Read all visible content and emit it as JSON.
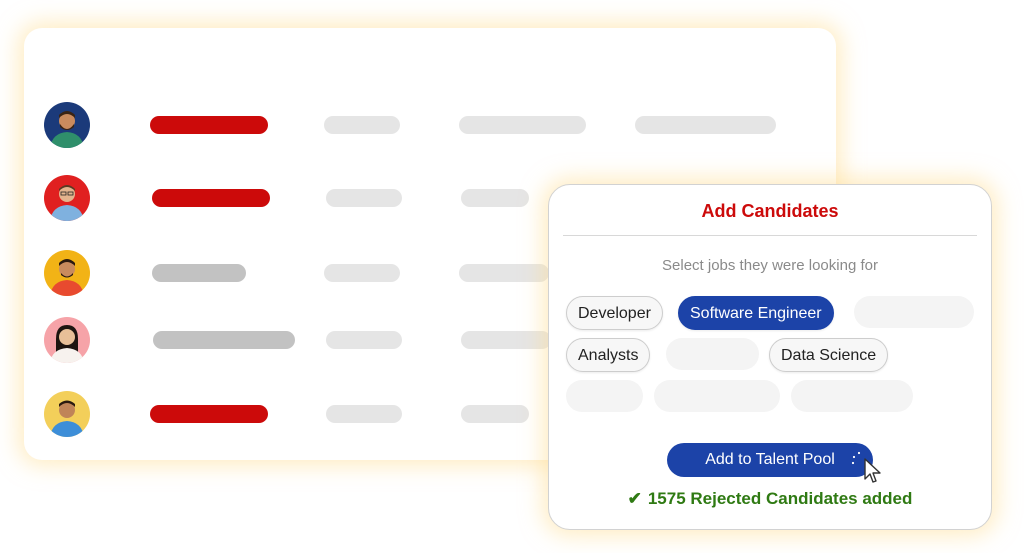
{
  "background_list": {
    "rows": [
      {
        "avatar": "person-avatar-1",
        "avatar_bg": "#1b3a7a",
        "status": "red"
      },
      {
        "avatar": "person-avatar-2",
        "avatar_bg": "#e02020",
        "status": "red"
      },
      {
        "avatar": "person-avatar-3",
        "avatar_bg": "#f2b316",
        "status": "gray"
      },
      {
        "avatar": "person-avatar-4",
        "avatar_bg": "#f6a3a8",
        "status": "gray"
      },
      {
        "avatar": "person-avatar-5",
        "avatar_bg": "#f3cf5a",
        "status": "red"
      }
    ]
  },
  "dialog": {
    "title": "Add Candidates",
    "subtitle": "Select jobs they were looking for",
    "chips": [
      {
        "label": "Developer",
        "selected": false
      },
      {
        "label": "Software Engineer",
        "selected": true
      },
      {
        "label": "Analysts",
        "selected": false
      },
      {
        "label": "Data Science",
        "selected": false
      }
    ],
    "button_label": "Add to Talent Pool",
    "success_icon": "check-icon",
    "success_message": "1575 Rejected Candidates added"
  },
  "colors": {
    "accent_red": "#cc0a0a",
    "primary_blue": "#1c43a8",
    "success_green": "#2f7a13"
  }
}
